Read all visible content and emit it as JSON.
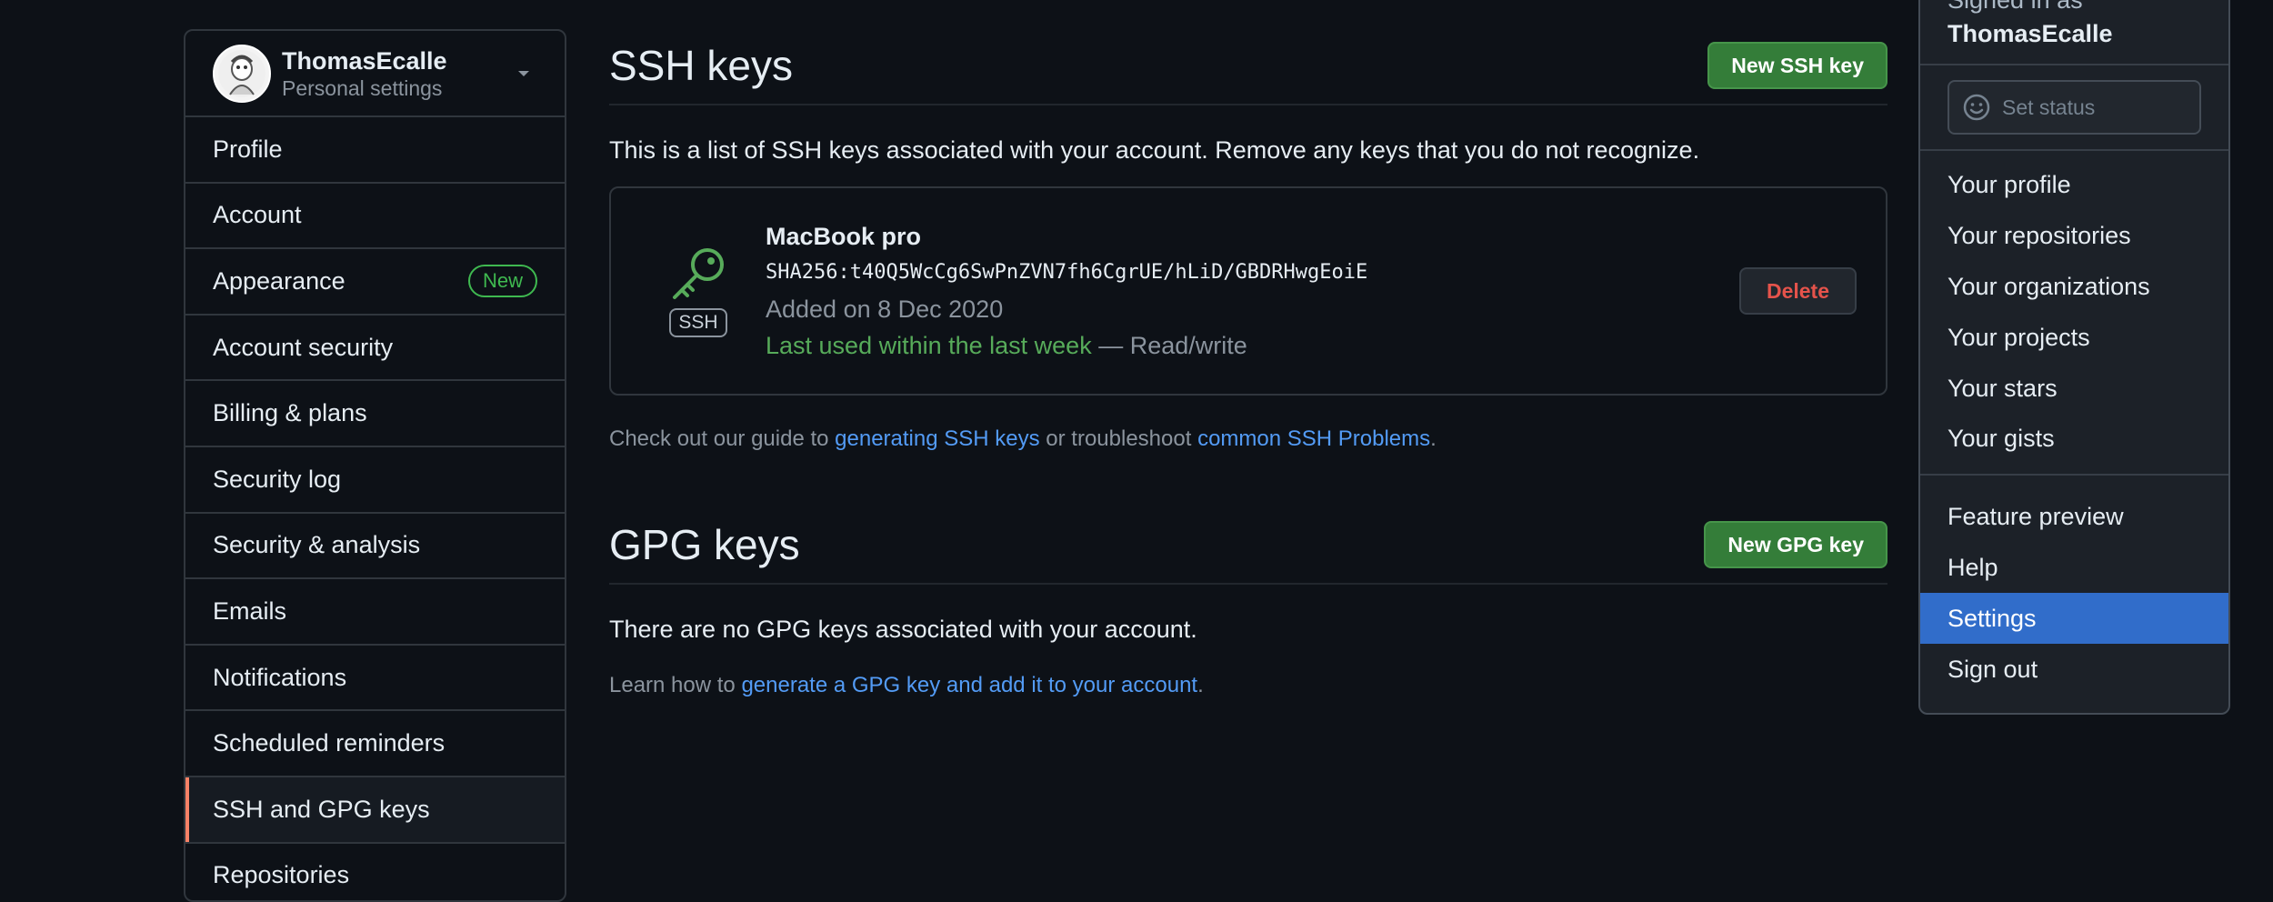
{
  "sidebar": {
    "user_name": "ThomasEcalle",
    "user_sub": "Personal settings",
    "items": [
      {
        "label": "Profile"
      },
      {
        "label": "Account"
      },
      {
        "label": "Appearance",
        "badge": "New"
      },
      {
        "label": "Account security"
      },
      {
        "label": "Billing & plans"
      },
      {
        "label": "Security log"
      },
      {
        "label": "Security & analysis"
      },
      {
        "label": "Emails"
      },
      {
        "label": "Notifications"
      },
      {
        "label": "Scheduled reminders"
      },
      {
        "label": "SSH and GPG keys",
        "active": true
      },
      {
        "label": "Repositories"
      }
    ]
  },
  "ssh": {
    "title": "SSH keys",
    "new_button": "New SSH key",
    "description": "This is a list of SSH keys associated with your account. Remove any keys that you do not recognize.",
    "key": {
      "tag": "SSH",
      "title": "MacBook pro",
      "fingerprint": "SHA256:t40Q5WcCg6SwPnZVN7fh6CgrUE/hLiD/GBDRHwgEoiE",
      "added": "Added on 8 Dec 2020",
      "last_used": "Last used within the last week",
      "access": " — Read/write",
      "delete_label": "Delete"
    },
    "guide_prefix": "Check out our guide to ",
    "guide_link1": "generating SSH keys",
    "guide_mid": " or troubleshoot ",
    "guide_link2": "common SSH Problems",
    "guide_suffix": "."
  },
  "gpg": {
    "title": "GPG keys",
    "new_button": "New GPG key",
    "empty": "There are no GPG keys associated with your account.",
    "learn_prefix": "Learn how to ",
    "learn_link": "generate a GPG key and add it to your account",
    "learn_suffix": "."
  },
  "dropdown": {
    "signed_label": "Signed in as",
    "signed_user": "ThomasEcalle",
    "status": "Set status",
    "group1": [
      "Your profile",
      "Your repositories",
      "Your organizations",
      "Your projects",
      "Your stars",
      "Your gists"
    ],
    "group2": [
      "Feature preview",
      "Help",
      "Settings",
      "Sign out"
    ],
    "selected": "Settings"
  },
  "colors": {
    "accent_active": "#f78166",
    "green": "#347d39",
    "selected_bg": "#316dca",
    "link": "#539bf5"
  }
}
